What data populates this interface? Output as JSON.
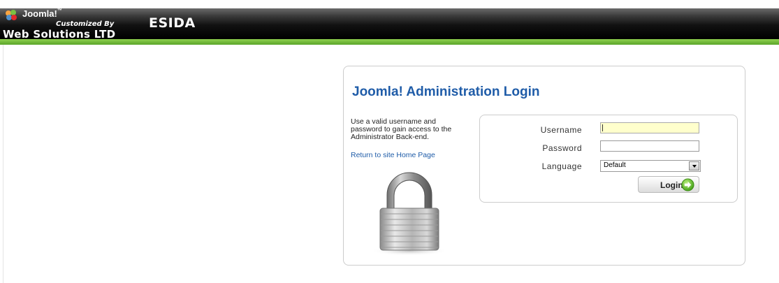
{
  "header": {
    "joomla_word": "Joomla!",
    "joomla_tm": "™",
    "customized_by": "Customized By",
    "company": "Web Solutions LTD",
    "site_name": "ESIDA"
  },
  "login": {
    "title": "Joomla! Administration Login",
    "help_text": "Use a valid username and password to gain access to the Administrator Back-end.",
    "home_link": "Return to site Home Page",
    "username_label": "Username",
    "username_value": "",
    "password_label": "Password",
    "password_value": "",
    "language_label": "Language",
    "language_value": "Default",
    "login_button": "Login"
  },
  "colors": {
    "title": "#1f5ca8",
    "green_bar": "#6cb43a",
    "active_input": "#ffffcc"
  },
  "icons": {
    "lock": "padlock-icon",
    "go": "green-arrow-circle-icon"
  }
}
